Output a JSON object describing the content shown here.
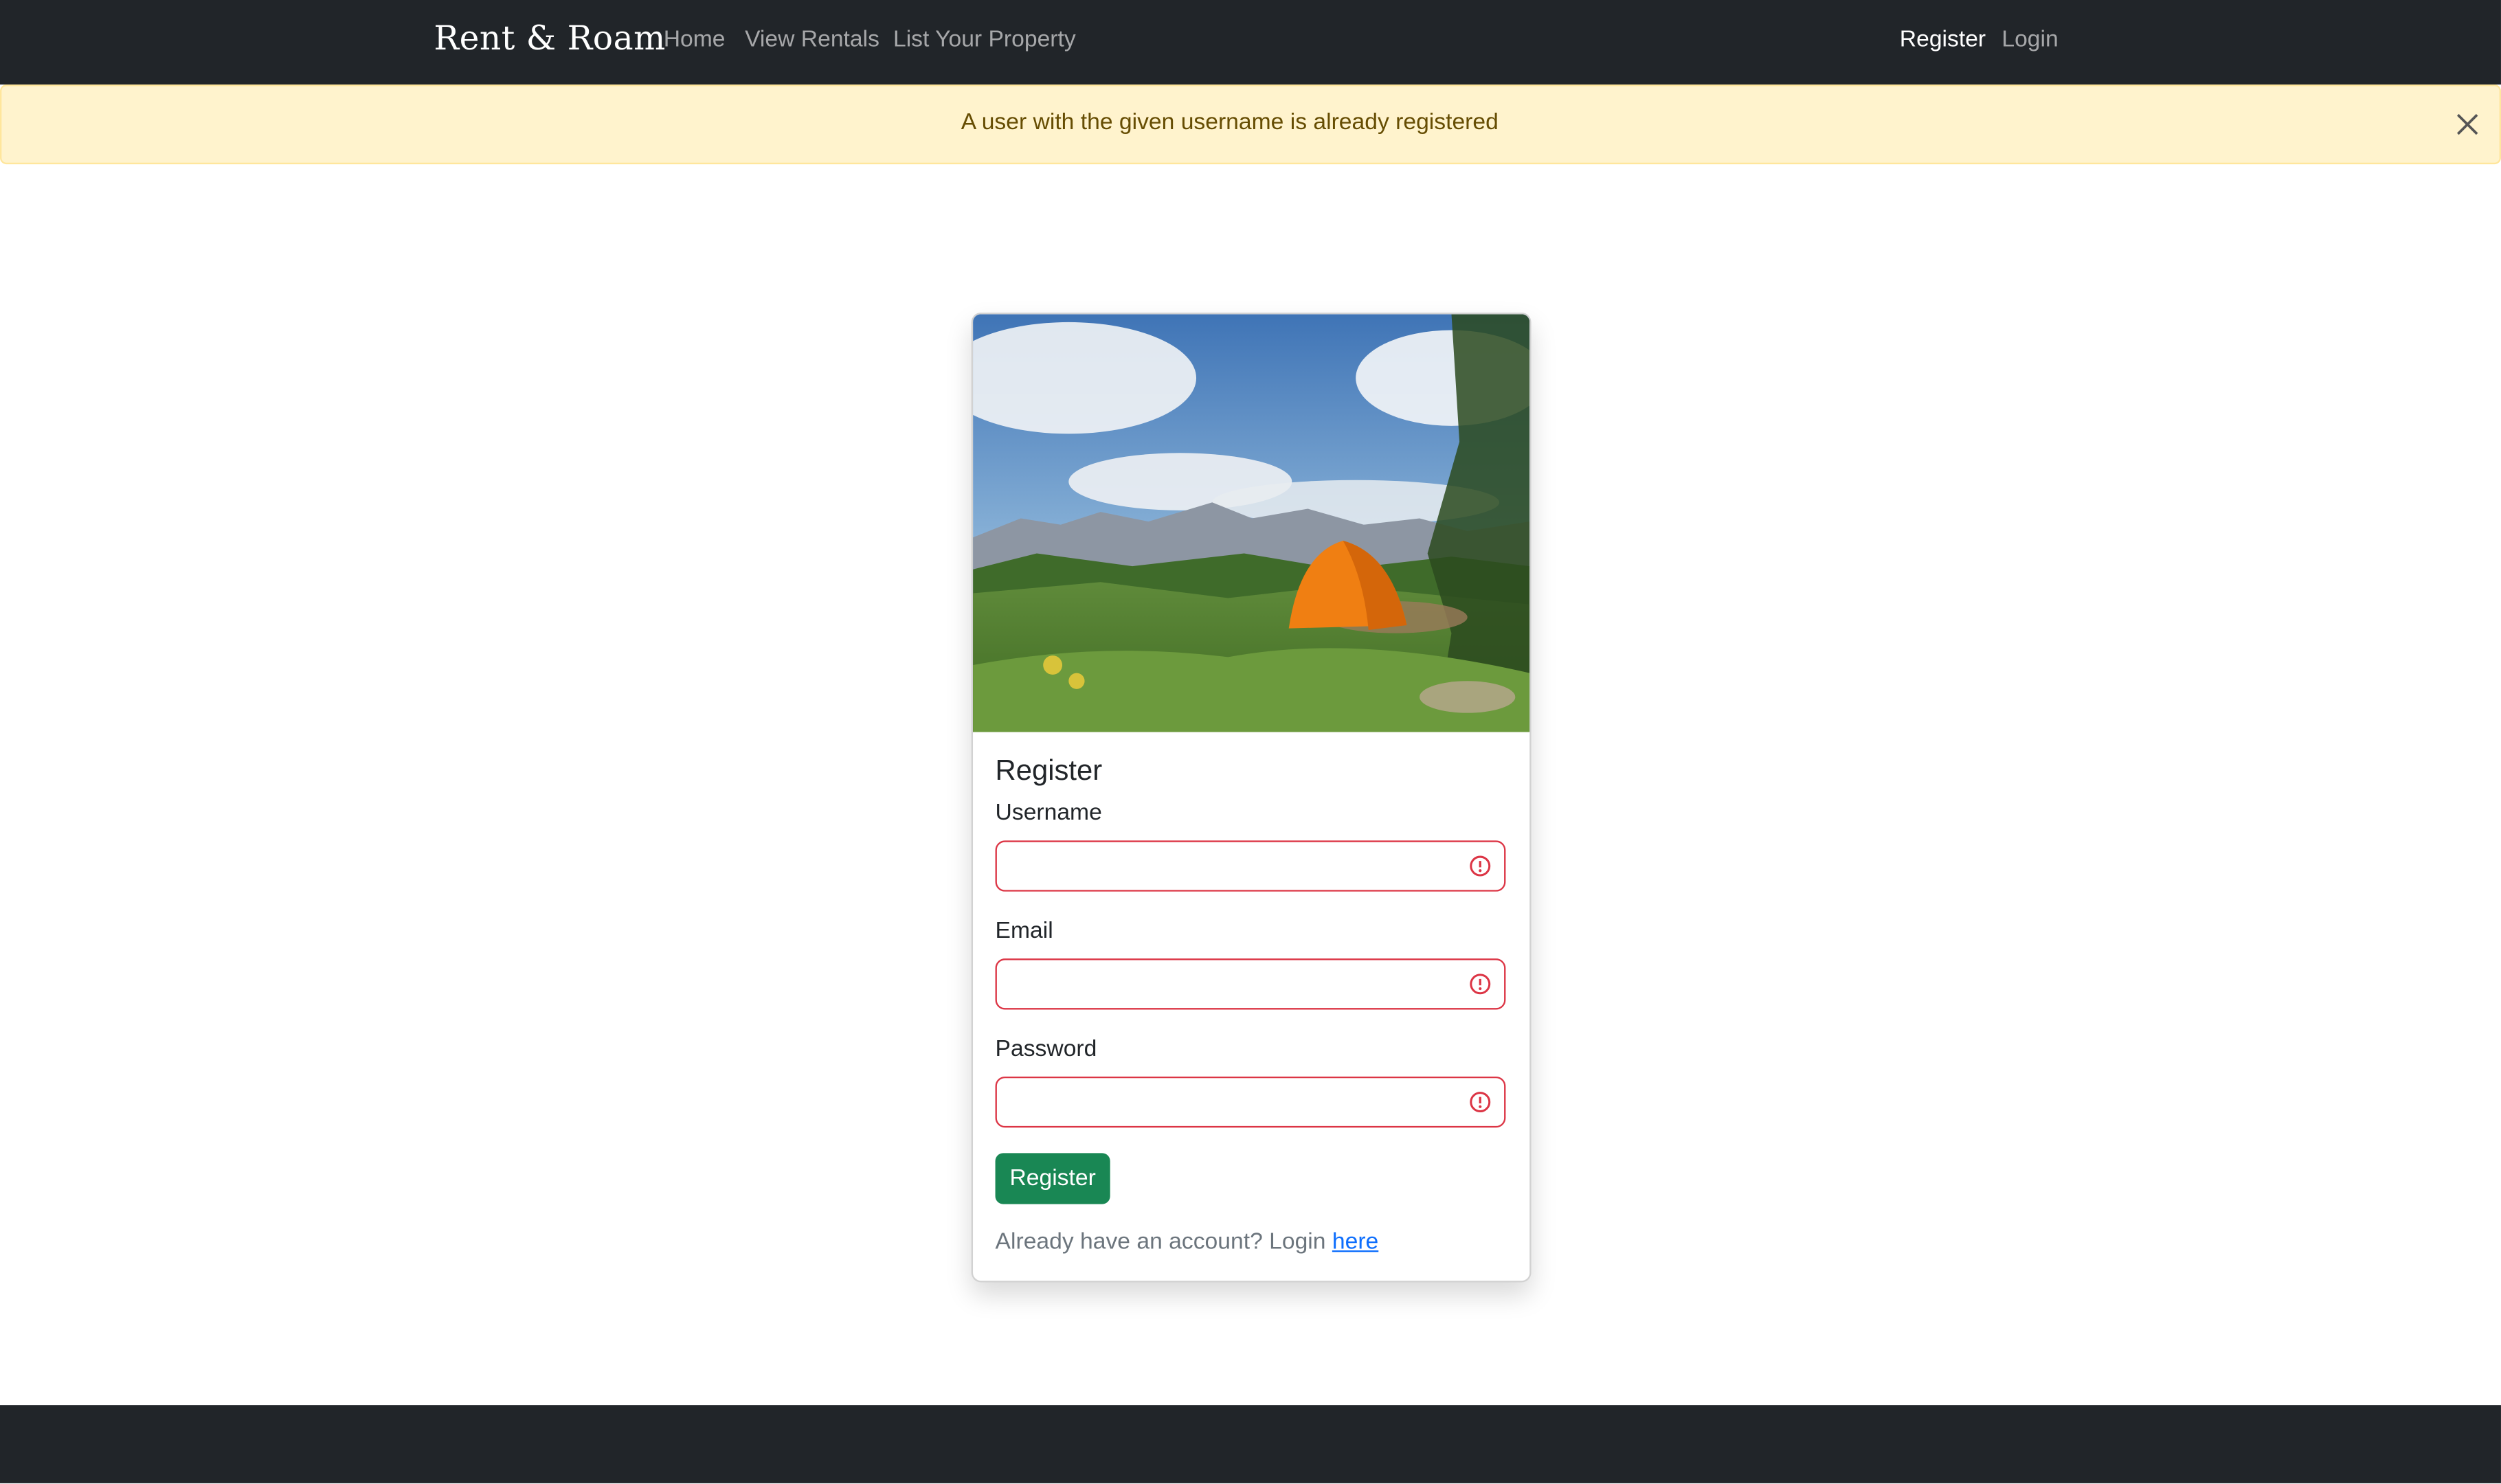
{
  "navbar": {
    "brand": "Rent & Roam",
    "links": [
      "Home",
      "View Rentals",
      "List Your Property"
    ],
    "right_links": [
      "Register",
      "Login"
    ]
  },
  "alert": {
    "message": "A user with the given username is already registered",
    "close_icon": "close-icon"
  },
  "card": {
    "image": "camping-tent-mountains-image",
    "title": "Register",
    "fields": [
      {
        "label": "Username",
        "value": "",
        "state": "invalid"
      },
      {
        "label": "Email",
        "value": "",
        "state": "invalid"
      },
      {
        "label": "Password",
        "value": "",
        "state": "invalid"
      }
    ],
    "submit_label": "Register",
    "footnote_prefix": "Already have an account? Login ",
    "footnote_link": "here"
  },
  "colors": {
    "navbar": "#212529",
    "alert_bg": "#fff3cd",
    "alert_text": "#664d03",
    "invalid": "#dc3545",
    "button": "#198754",
    "link": "#0d6efd"
  }
}
